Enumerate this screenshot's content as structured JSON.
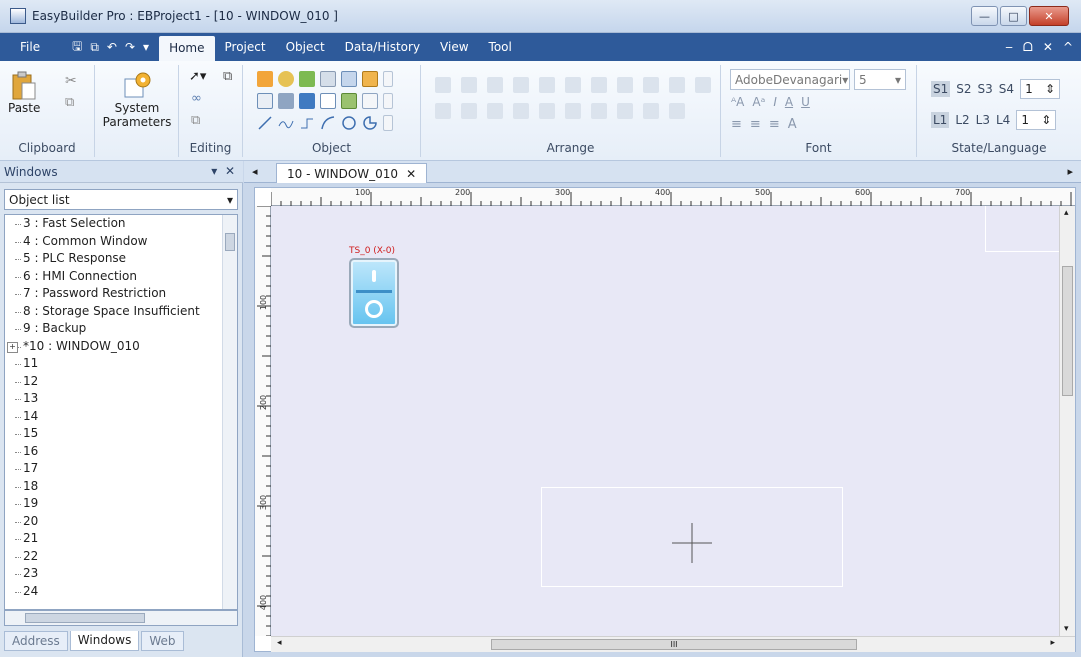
{
  "window": {
    "title": "EasyBuilder Pro : EBProject1 - [10 - WINDOW_010 ]",
    "min_label": "—",
    "max_label": "□",
    "close_label": "✕"
  },
  "menubar": {
    "file": "File",
    "tabs": [
      "Home",
      "Project",
      "Object",
      "Data/History",
      "View",
      "Tool"
    ],
    "mdi": [
      "‒",
      "ᗝ",
      "✕",
      "^"
    ]
  },
  "ribbon": {
    "groups": [
      "Clipboard",
      "Editing",
      "Object",
      "Arrange",
      "Font",
      "State/Language"
    ],
    "paste": "Paste",
    "system_params": [
      "System",
      "Parameters"
    ],
    "font_name": "AdobeDevanagari",
    "font_size": "5",
    "states": [
      "S1",
      "S2",
      "S3",
      "S4"
    ],
    "state_value": "1",
    "languages": [
      "L1",
      "L2",
      "L3",
      "L4"
    ],
    "lang_value": "1",
    "font_buttons": [
      "ᴬA",
      "Aᵃ",
      "I",
      "A",
      "U"
    ]
  },
  "left_panel": {
    "title": "Windows",
    "selector": "Object list",
    "items": [
      "3 : Fast Selection",
      "4 : Common Window",
      "5 : PLC Response",
      "6 : HMI Connection",
      "7 : Password Restriction",
      "8 : Storage Space Insufficient",
      "9 : Backup",
      "*10 : WINDOW_010",
      "11",
      "12",
      "13",
      "14",
      "15",
      "16",
      "17",
      "18",
      "19",
      "20",
      "21",
      "22",
      "23",
      "24"
    ],
    "tabs": [
      "Address",
      "Windows",
      "Web"
    ]
  },
  "document": {
    "tab_label": "10 - WINDOW_010",
    "ruler_h": [
      "100",
      "200",
      "300",
      "400",
      "500",
      "600",
      "700"
    ],
    "ruler_v": [
      "100",
      "200",
      "300",
      "400"
    ],
    "toggle_label": "TS_0 (X-0)",
    "hscroll_label": "III"
  },
  "colors": {
    "menubar": "#2e5a9a",
    "workspace": "#e8e8f6",
    "toggle": "#64c3ef",
    "label_red": "#d01c1c"
  }
}
